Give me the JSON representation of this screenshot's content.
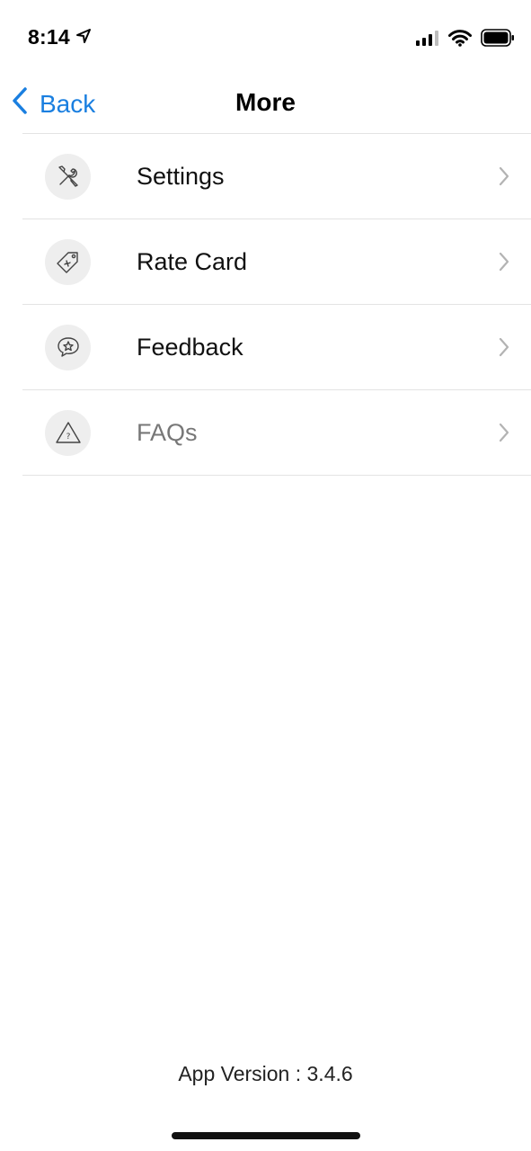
{
  "status_bar": {
    "time": "8:14",
    "icons": [
      "location-arrow-icon",
      "cellular-signal-icon",
      "wifi-icon",
      "battery-icon"
    ]
  },
  "nav": {
    "back_label": "Back",
    "title": "More",
    "accent_color": "#1a7fe0"
  },
  "menu": {
    "items": [
      {
        "label": "Settings",
        "icon": "tools-icon"
      },
      {
        "label": "Rate Card",
        "icon": "price-tag-icon"
      },
      {
        "label": "Feedback",
        "icon": "star-chat-icon"
      },
      {
        "label": "FAQs",
        "icon": "warning-question-icon"
      }
    ]
  },
  "footer": {
    "app_version": "App Version : 3.4.6"
  }
}
